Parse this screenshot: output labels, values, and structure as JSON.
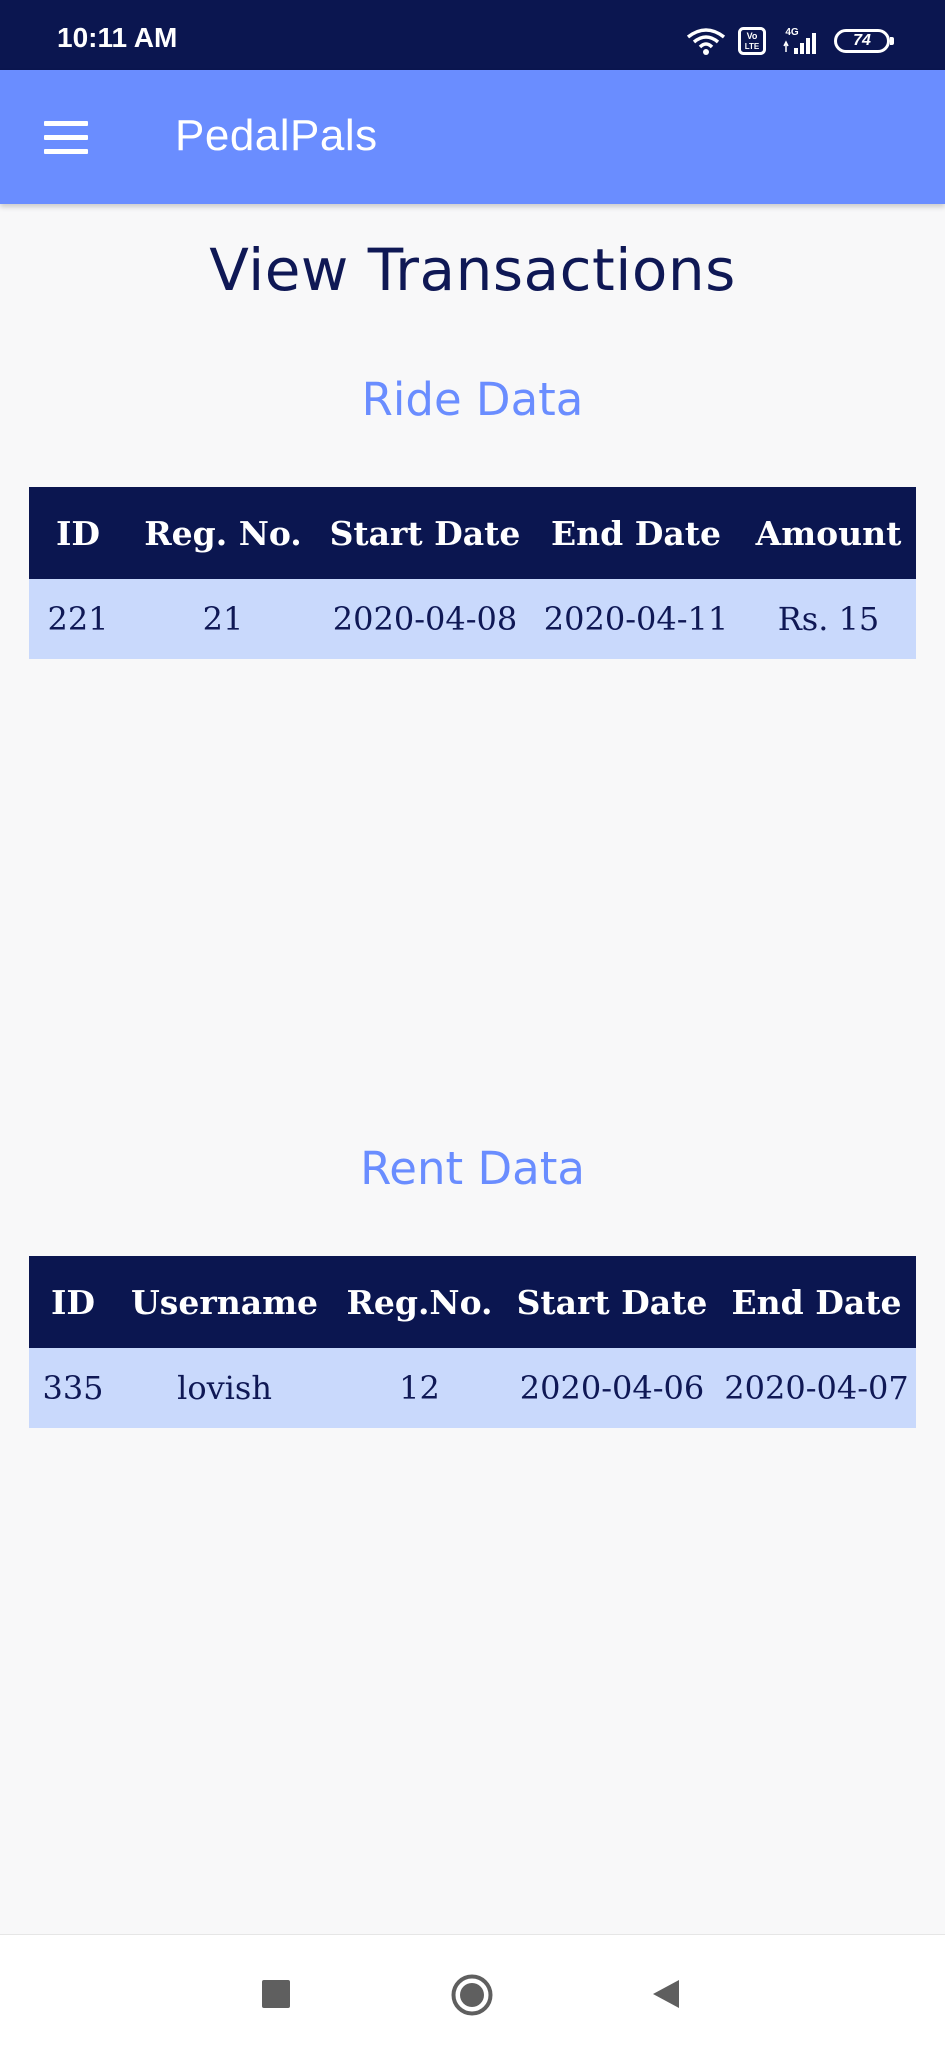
{
  "status_bar": {
    "time": "10:11 AM",
    "network": "4G",
    "volte": "Vo LTE",
    "battery": "74"
  },
  "app_bar": {
    "title": "PedalPals",
    "menu_icon": "hamburger-menu-icon"
  },
  "page": {
    "title": "View Transactions"
  },
  "ride": {
    "heading": "Ride Data",
    "columns": [
      "ID",
      "Reg. No.",
      "Start Date",
      "End Date",
      "Amount"
    ],
    "rows": [
      [
        "221",
        "21",
        "2020-04-08",
        "2020-04-11",
        "Rs. 15"
      ]
    ]
  },
  "rent": {
    "heading": "Rent Data",
    "columns": [
      "ID",
      "Username",
      "Reg.No.",
      "Start Date",
      "End Date"
    ],
    "rows": [
      [
        "335",
        "lovish",
        "12",
        "2020-04-06",
        "2020-04-07"
      ]
    ]
  },
  "nav_bar": {
    "recent_icon": "square-recents-icon",
    "home_icon": "circle-home-icon",
    "back_icon": "triangle-back-icon"
  },
  "colors": {
    "status_bar": "#0b1650",
    "app_bar": "#6a8dff",
    "table_header": "#0b1650",
    "table_row": "#c9d9fc",
    "heading_accent": "#6a8dff"
  }
}
